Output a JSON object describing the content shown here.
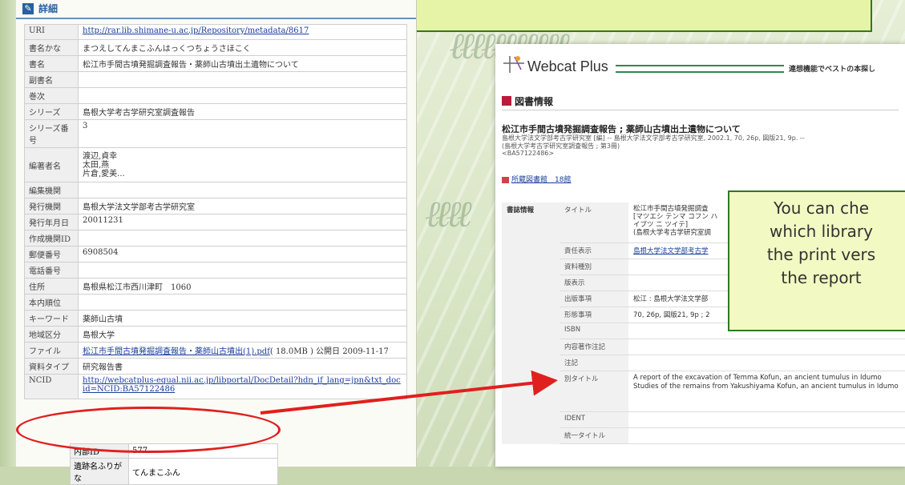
{
  "doc": {
    "header_label": "詳細",
    "rows": [
      {
        "key": "URI",
        "value": "http://rar.lib.shimane-u.ac.jp/Repository/metadata/8617"
      },
      {
        "key": "書名かな",
        "value": "まつえしてんまこふんはっくつちょうさほこく"
      },
      {
        "key": "書名",
        "value": "松江市手間古墳発掘調査報告・薬師山古墳出土遺物について"
      },
      {
        "key": "副書名",
        "value": ""
      },
      {
        "key": "巻次",
        "value": ""
      },
      {
        "key": "シリーズ",
        "value": "島根大学考古学研究室調査報告"
      },
      {
        "key": "シリーズ番号",
        "value": "3"
      },
      {
        "key": "編著者名",
        "value": "渡辺,貞幸\n太田,燕\n片倉,愛美..."
      },
      {
        "key": "編集機関",
        "value": ""
      },
      {
        "key": "発行機関",
        "value": "島根大学法文学部考古学研究室"
      },
      {
        "key": "発行年月日",
        "value": "20011231"
      },
      {
        "key": "作成機関ID",
        "value": ""
      },
      {
        "key": "郵便番号",
        "value": "6908504"
      },
      {
        "key": "電話番号",
        "value": ""
      },
      {
        "key": "住所",
        "value": "島根県松江市西川津町　1060"
      },
      {
        "key": "本内順位",
        "value": ""
      },
      {
        "key": "キーワード",
        "value": "薬師山古墳"
      },
      {
        "key": "地域区分",
        "value": "島根大学"
      },
      {
        "key": "ファイル",
        "value": "松江市手間古墳発掘調査報告・薬師山古墳出(1).pdf",
        "extra": "( 18.0MB ) 公開日 2009-11-17"
      },
      {
        "key": "資料タイプ",
        "value": "研究報告書"
      },
      {
        "key": "NCID",
        "value": "http://webcatplus-equal.nii.ac.jp/libportal/DocDetail?hdn_if_lang=jpn&txt_docid=NCID:BA57122486"
      }
    ],
    "inner_rows": [
      {
        "key": "内部ID",
        "value": "577"
      },
      {
        "key": "遺跡名ふりがな",
        "value": "てんまこふん"
      }
    ]
  },
  "webcat": {
    "title": "Webcat Plus",
    "tagline": "連想機能でベストの本探し",
    "section_heading": "図書情報",
    "book_title": "松江市手間古墳発掘調査報告 ; 薬師山古墳出土遺物について",
    "book_sub": "島根大学法文学部考古学研究室 [編] -- 島根大学法文学部考古学研究室, 2002.1, 70, 26p, 図版21, 9p. --",
    "book_sub2": "(島根大学考古学研究室調査報告 ; 第3冊)",
    "book_id": "<BA57122486>",
    "holdings": "所蔵図書館　18館",
    "bib_label": "書誌情報",
    "rows": [
      {
        "key": "タイトル",
        "value": "松江市手間古墳発掘調査\n[マツエシ テンマ コフン ハ\nイブツ ニ ツイテ]\n(島根大学考古学研究室調"
      },
      {
        "key": "責任表示",
        "value": "島根大学法文学部考古学"
      },
      {
        "key": "資料種別",
        "value": ""
      },
      {
        "key": "版表示",
        "value": ""
      },
      {
        "key": "出版事項",
        "value": "松江 : 島根大学法文学部"
      },
      {
        "key": "形態事項",
        "value": "70, 26p, 図版21, 9p ; 2"
      },
      {
        "key": "ISBN",
        "value": ""
      },
      {
        "key": "内容著作注記",
        "value": ""
      },
      {
        "key": "注記",
        "value": ""
      },
      {
        "key": "別タイトル",
        "value": "A report of the excavation of Temma Kofun, an ancient tumulus in Idumo\nStudies of the remains from Yakushiyama Kofun, an ancient tumulus in Idumo"
      },
      {
        "key": "IDENT",
        "value": ""
      },
      {
        "key": "統一タイトル",
        "value": ""
      }
    ]
  },
  "callout": {
    "line1": "You can che",
    "line2": "which library",
    "line3": "the print vers",
    "line4": "the report"
  },
  "colors": {
    "callout_border": "#2e7a1e",
    "callout_bg": "#f3f9c2",
    "highlight": "#e0201e",
    "link": "#1a3d9a"
  }
}
